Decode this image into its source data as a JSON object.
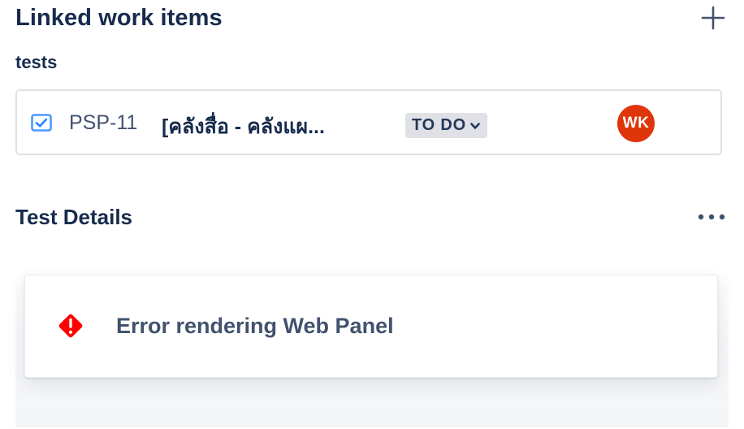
{
  "linked_items": {
    "title": "Linked work items",
    "add_icon": "plus-icon",
    "group_label": "tests",
    "items": [
      {
        "type_icon": "task-checkbox-icon",
        "key": "PSP-11",
        "summary": "[คลังสื่อ - คลังแผ...",
        "status": "TO DO",
        "status_icon": "chevron-down-icon",
        "assignee_initials": "WK",
        "assignee_color": "#de350b"
      }
    ]
  },
  "test_details": {
    "title": "Test Details",
    "more_icon": "more-horizontal-icon"
  },
  "error_panel": {
    "icon": "error-diamond-icon",
    "icon_color": "#ff0000",
    "message": "Error rendering Web Panel"
  }
}
